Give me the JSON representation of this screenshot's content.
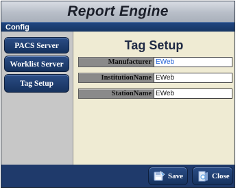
{
  "app": {
    "title": "Report Engine"
  },
  "section": {
    "title": "Config"
  },
  "sidebar": {
    "items": [
      {
        "label": "PACS Server"
      },
      {
        "label": "Worklist Server"
      },
      {
        "label": "Tag Setup"
      }
    ]
  },
  "main": {
    "heading": "Tag Setup",
    "fields": [
      {
        "label": "Manufacturer",
        "value": "EWeb"
      },
      {
        "label": "InstitutionName",
        "value": "EWeb"
      },
      {
        "label": "StationName",
        "value": "EWeb"
      }
    ]
  },
  "footer": {
    "save_label": "Save",
    "close_label": "Close"
  },
  "colors": {
    "accent": "#1f3a6b",
    "content_bg": "#efebd3",
    "sidebar_bg": "#c7c7c7",
    "label_bg": "#8a8a8a"
  },
  "icons": {
    "save": "save-icon",
    "close": "close-icon"
  }
}
